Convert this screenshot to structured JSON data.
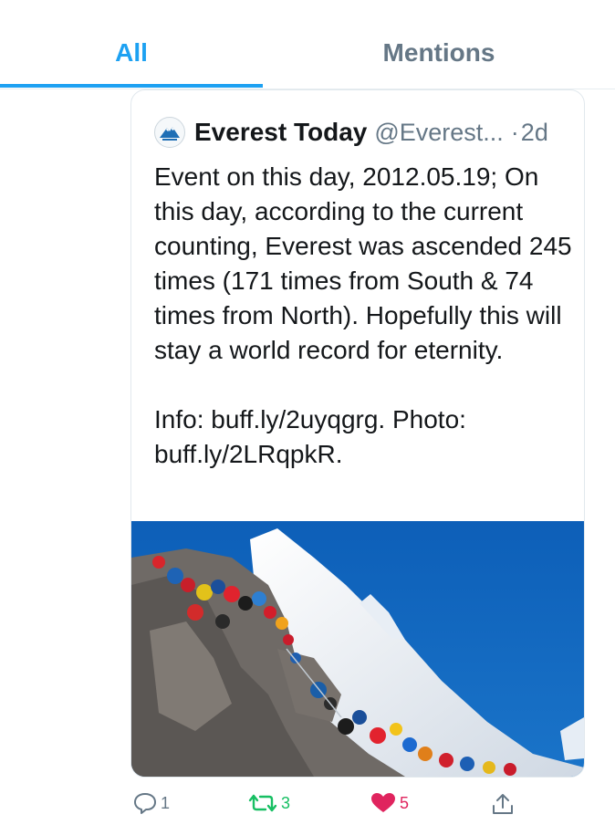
{
  "tabs": [
    {
      "label": "All",
      "active": true
    },
    {
      "label": "Mentions",
      "active": false
    }
  ],
  "tweet": {
    "author_name": "Everest Today",
    "handle": "@Everest...",
    "separator": "·",
    "time": "2d",
    "text": "Event on this day, 2012.05.19; On this day, according to the current counting, Everest was ascended 245 times (171 times from South & 74 times from North). Hopefully this will stay a world record for eternity.\n\nInfo: buff.ly/2uyqgrg. Photo: buff.ly/2LRqpkR.",
    "avatar_icon": "everest-logo-icon",
    "photo_subject": "climbers queue on snowy ridge"
  },
  "actions": {
    "reply": {
      "icon": "reply-icon",
      "count": "1"
    },
    "retweet": {
      "icon": "retweet-icon",
      "count": "3"
    },
    "like": {
      "icon": "heart-icon",
      "count": "5"
    },
    "share": {
      "icon": "share-icon",
      "count": ""
    }
  },
  "colors": {
    "accent": "#1da1f2",
    "muted": "#657786",
    "retweet": "#17bf63",
    "like": "#e0245e",
    "sky": "#1565c0"
  }
}
